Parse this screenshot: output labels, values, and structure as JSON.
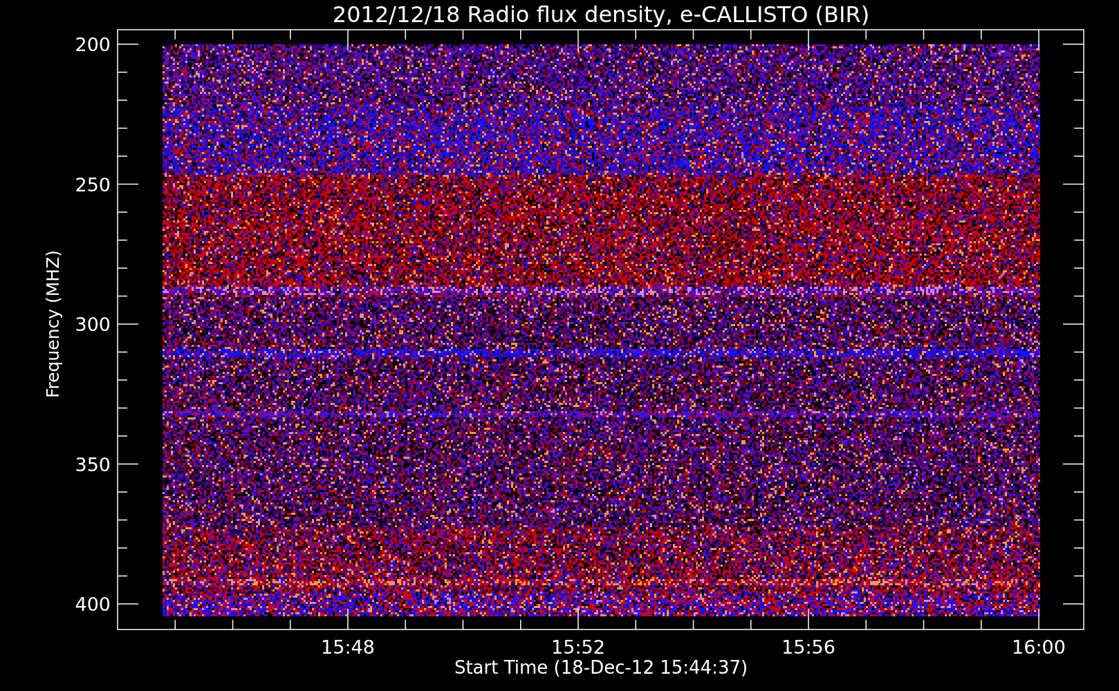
{
  "title": "2012/12/18  Radio flux density, e-CALLISTO (BIR)",
  "y_axis": {
    "label": "Frequency (MHZ)",
    "ticks": [
      "200",
      "250",
      "300",
      "350",
      "400"
    ]
  },
  "x_axis": {
    "label": "Start Time (18-Dec-12 15:44:37)",
    "ticks": [
      "15:48",
      "15:52",
      "15:56",
      "16:00"
    ]
  }
}
